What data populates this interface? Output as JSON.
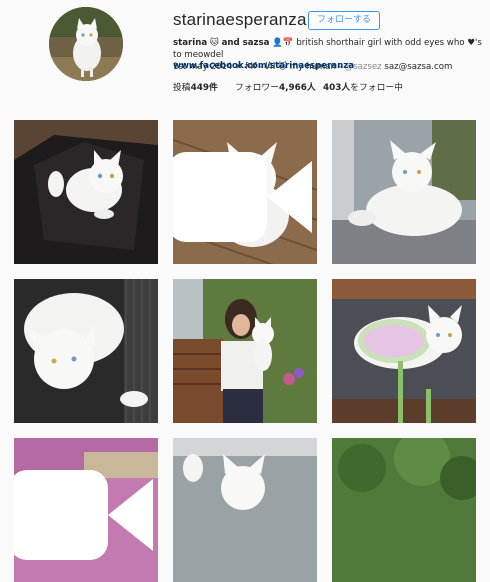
{
  "profile": {
    "username": "starinaesperanza",
    "follow_label": "フォローする",
    "bio_line1_name": "starina",
    "bio_line1_mid": "and sazsa",
    "bio_line1_rest": "british shorthair girl with odd eyes who",
    "bio_line1_tail": "'s to meowdel",
    "bio_line2_a": "1st may 2014",
    "bio_line2_b": "f4f - l4l",
    "bio_line2_c": "my human -",
    "bio_line2_d": "@sazsez",
    "bio_line2_e": "saz@sazsa.com",
    "website": "www.facebook.com/starinaesperanza",
    "posts_label": "投稿",
    "posts_value": "449件",
    "followers_label": "フォロワー",
    "followers_value": "4,966人",
    "following_value": "403人",
    "following_label": "をフォロー中"
  },
  "icons": {
    "cat_emoji": "cat-face-icon",
    "profile_emoji": "person-silhouette-icon",
    "calendar_emoji": "calendar-icon",
    "cross_emoji": "crossed-swords-icon",
    "heart_emoji": "heart-icon",
    "camera": "video-camera-icon"
  },
  "colors": {
    "accent": "#3897f0",
    "link": "#003569",
    "background": "#fafafa"
  },
  "posts": [
    {
      "id": "post-1",
      "video": false
    },
    {
      "id": "post-2",
      "video": true
    },
    {
      "id": "post-3",
      "video": false
    },
    {
      "id": "post-4",
      "video": false
    },
    {
      "id": "post-5",
      "video": false
    },
    {
      "id": "post-6",
      "video": false
    },
    {
      "id": "post-7",
      "video": true
    },
    {
      "id": "post-8",
      "video": false
    },
    {
      "id": "post-9",
      "video": false
    }
  ]
}
